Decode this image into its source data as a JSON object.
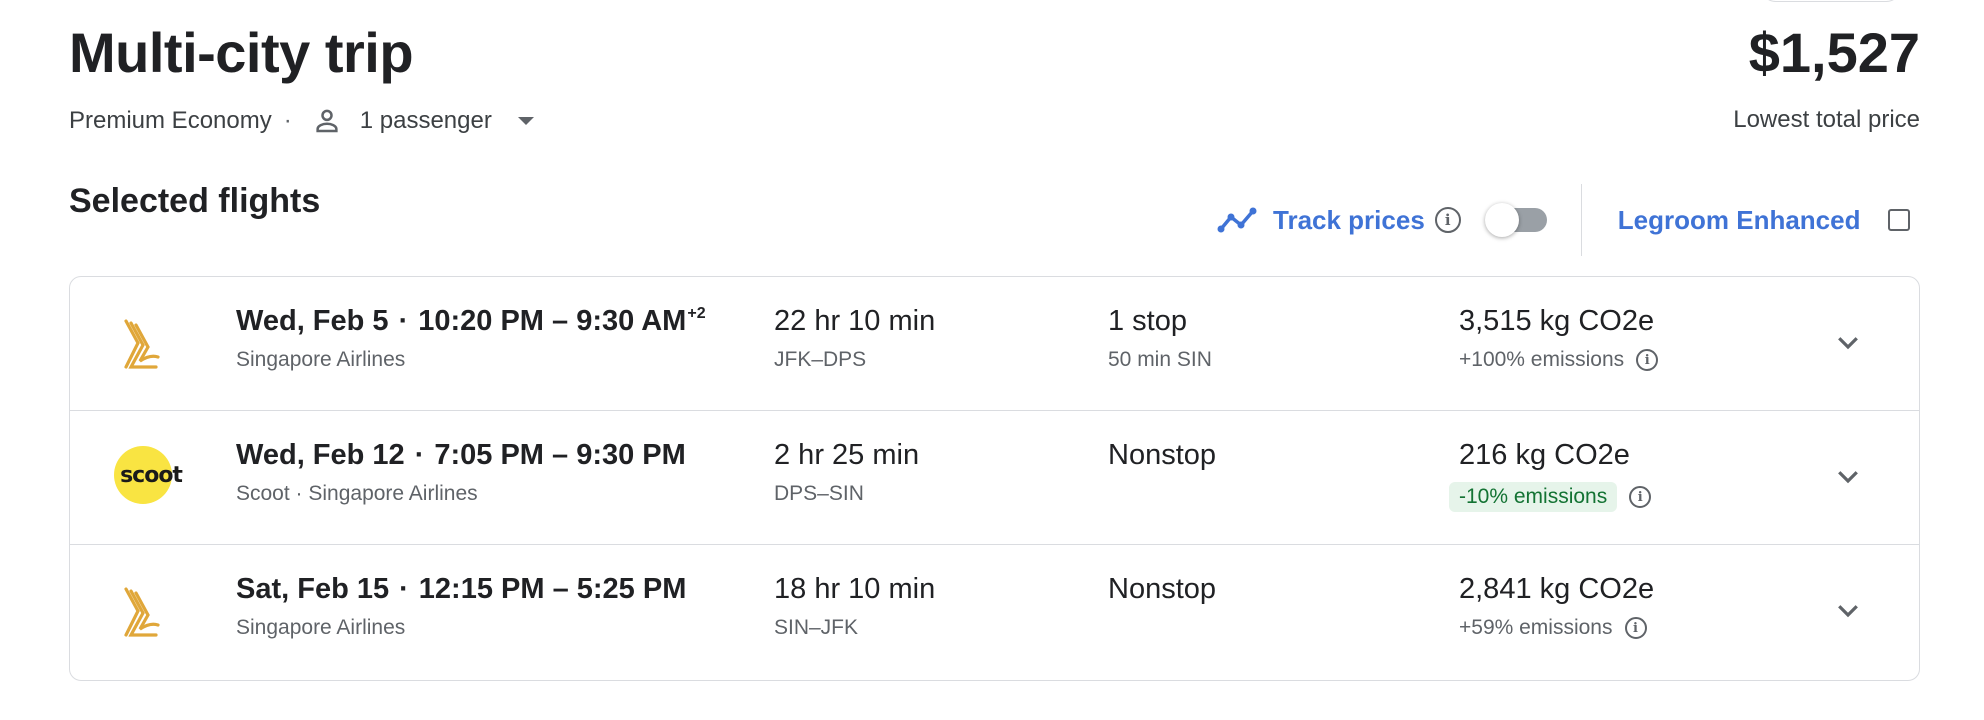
{
  "header": {
    "title": "Multi-city trip",
    "cabin_class": "Premium Economy",
    "separator": "·",
    "passengers": "1 passenger",
    "price": "$1,527",
    "price_label": "Lowest total price"
  },
  "section": {
    "title": "Selected flights"
  },
  "controls": {
    "track_prices_label": "Track prices",
    "track_prices_enabled": false,
    "legroom_label": "Legroom Enhanced",
    "legroom_checked": false,
    "info_glyph": "i"
  },
  "colors": {
    "accent_blue": "#3f73d6",
    "green_badge_bg": "#e6f4ea",
    "green_badge_text": "#137333",
    "singapore_gold": "#e0a73a",
    "scoot_yellow": "#f9e442"
  },
  "flights": [
    {
      "logo": "singapore-airlines-logo",
      "date": "Wed, Feb 5",
      "dot": "·",
      "times": "10:20 PM – 9:30 AM",
      "day_offset": "+2",
      "airline": "Singapore Airlines",
      "duration": "22 hr 10 min",
      "route": "JFK–DPS",
      "stops": "1 stop",
      "layover": "50 min SIN",
      "emissions": "3,515 kg CO2e",
      "emissions_delta": "+100% emissions",
      "emissions_good": false
    },
    {
      "logo": "scoot-logo",
      "logo_text": "scoot",
      "date": "Wed, Feb 12",
      "dot": "·",
      "times": "7:05 PM – 9:30 PM",
      "day_offset": "",
      "airline": "Scoot · Singapore Airlines",
      "duration": "2 hr 25 min",
      "route": "DPS–SIN",
      "stops": "Nonstop",
      "layover": "",
      "emissions": "216 kg CO2e",
      "emissions_delta": "-10% emissions",
      "emissions_good": true
    },
    {
      "logo": "singapore-airlines-logo",
      "date": "Sat, Feb 15",
      "dot": "·",
      "times": "12:15 PM – 5:25 PM",
      "day_offset": "",
      "airline": "Singapore Airlines",
      "duration": "18 hr 10 min",
      "route": "SIN–JFK",
      "stops": "Nonstop",
      "layover": "",
      "emissions": "2,841 kg CO2e",
      "emissions_delta": "+59% emissions",
      "emissions_good": false
    }
  ]
}
